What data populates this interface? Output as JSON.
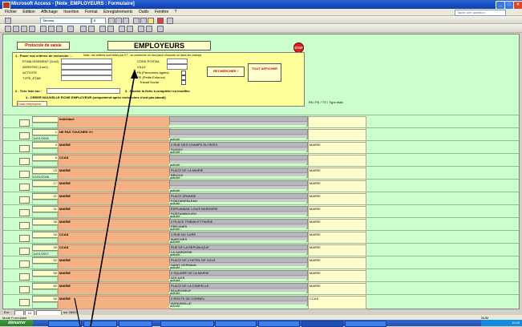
{
  "window": {
    "title": "Microsoft Access - [Note_EMPLOYEURS : Formulaire]",
    "close_glyph": "×",
    "minimize_glyph": "_",
    "maximize_glyph": "□"
  },
  "menu": {
    "items": [
      "Fichier",
      "Edition",
      "Affichage",
      "Insertion",
      "Format",
      "Enregistrements",
      "Outils",
      "Fenêtre",
      "?"
    ],
    "help_placeholder": "Tapez une question"
  },
  "toolbar": {
    "font_name": "Tahoma",
    "font_size": "8"
  },
  "form": {
    "protocol_button": "Protocole de saisie",
    "title": "EMPLOYEURS",
    "stop_label": "STOP",
    "section1_title": "1 - Poser vos critères de recherche ...",
    "section1_note": "Note : les critères sont reliés par ET ; on recherche un mot placé n'importe où dans les champs",
    "fields_left": [
      "ETABLISSEMENT (1ou2)",
      "ADRESSE (1ou2)",
      "ACTIVITE",
      "TYPE_ETAB"
    ],
    "fields_right": [
      "CODE POSTAL",
      "VILLE",
      "PA (Personnes âgées)",
      "PE (Petite Enfance)",
      "Travail Social"
    ],
    "search_button": "RECHERCHER !",
    "all_button": "TOUT AFFICHER",
    "section2_label": "2 - Trier liste sur :",
    "section3_label": "3 - Choisir la fiche à compléter ou modifier",
    "section4_label": "4 - CREER NOUVELLE FICHE EMPLOYEUR (uniquement après recherches n'ont pas abouti)",
    "sort_header": "Code employeur",
    "flag_header": "PA / PE / TS / Type étab"
  },
  "rows": [
    {
      "num": "",
      "date": "",
      "name": "Individuel",
      "addr": "",
      "city": "",
      "act": "",
      "flags": ""
    },
    {
      "num": "1",
      "date": "11/01/2006",
      "name": "NE PAS TOUCHER !!!!",
      "addr": "",
      "city": "",
      "act": "activité :",
      "flags": ""
    },
    {
      "num": "4",
      "date": "",
      "name": "MAIRIE",
      "addr": "2 RUE DES CHAMPS ELYSEES",
      "city": "ROISSY",
      "act": "activité :",
      "flags": "MAIRIE"
    },
    {
      "num": "6",
      "date": "",
      "name": "CCAS",
      "addr": "",
      "city": "",
      "act": "activité :",
      "flags": ""
    },
    {
      "num": "15",
      "date": "01/01/2006",
      "name": "MAIRIE",
      "addr": "PLACE DE LA MAIRIE",
      "city": "BRIOUX",
      "act": "activité :",
      "flags": "MAIRIE"
    },
    {
      "num": "17",
      "date": "",
      "name": "MAIRIE",
      "addr": "",
      "city": "",
      "act": "activité :",
      "flags": "MAIRIE"
    },
    {
      "num": "21",
      "date": "",
      "name": "MAIRIE",
      "addr": "PLACE GRANDE",
      "city": "FONTAINEBLEAU",
      "act": "activité :",
      "flags": "MAIRIE"
    },
    {
      "num": "31",
      "date": "",
      "name": "MAIRIE",
      "addr": "ESPLANADE LOUIS BARDIERE",
      "city": "PORTAINBOURG",
      "act": "activité :",
      "flags": "MAIRIE"
    },
    {
      "num": "35",
      "date": "",
      "name": "MAIRIE",
      "addr": "2 PLACE TRIBAN ET PAIRIE",
      "city": "PREVINES",
      "act": "activité :",
      "flags": "MAIRIE"
    },
    {
      "num": "40",
      "date": "",
      "name": "CCAS",
      "addr": "1 RUE DU CURE",
      "city": "MARCHES",
      "act": "activité :",
      "flags": "MAIRIE"
    },
    {
      "num": "49",
      "date": "11/01/2007",
      "name": "CCAS",
      "addr": "RUE DE LA REPUBLIQUE",
      "city": "LA GARDERIE",
      "act": "activité :",
      "flags": "MAIRIE"
    },
    {
      "num": "52",
      "date": "",
      "name": "MAIRIE",
      "addr": "PLACE DE L'HOTEL DE VILLE",
      "city": "SAINT-GERMAIN",
      "act": "activité :",
      "flags": "MAIRIE"
    },
    {
      "num": "56",
      "date": "",
      "name": "MAIRIE",
      "addr": "2 SQUARE DE LA MAIRIE",
      "city": "LES ILES",
      "act": "activité :",
      "flags": "MAIRIE"
    },
    {
      "num": "60",
      "date": "",
      "name": "MAIRIE",
      "addr": "PLACE DE LA CHAPELLE",
      "city": "BOURGNEUF",
      "act": "activité :",
      "flags": "MAIRIE"
    },
    {
      "num": "66",
      "date": "",
      "name": "MAIRIE",
      "addr": "2 ROUTE DE CORBEIL",
      "city": "AVRAINVILLE",
      "act": "activité :",
      "flags": "CCAS"
    }
  ],
  "nav": {
    "record_label": "Enr :",
    "current": "14",
    "total_label": "sur 28924"
  },
  "status": {
    "mode": "Mode Formulaire",
    "right": "NUM"
  },
  "taskbar": {
    "start_label": "démarrer",
    "clock": "15:48"
  }
}
